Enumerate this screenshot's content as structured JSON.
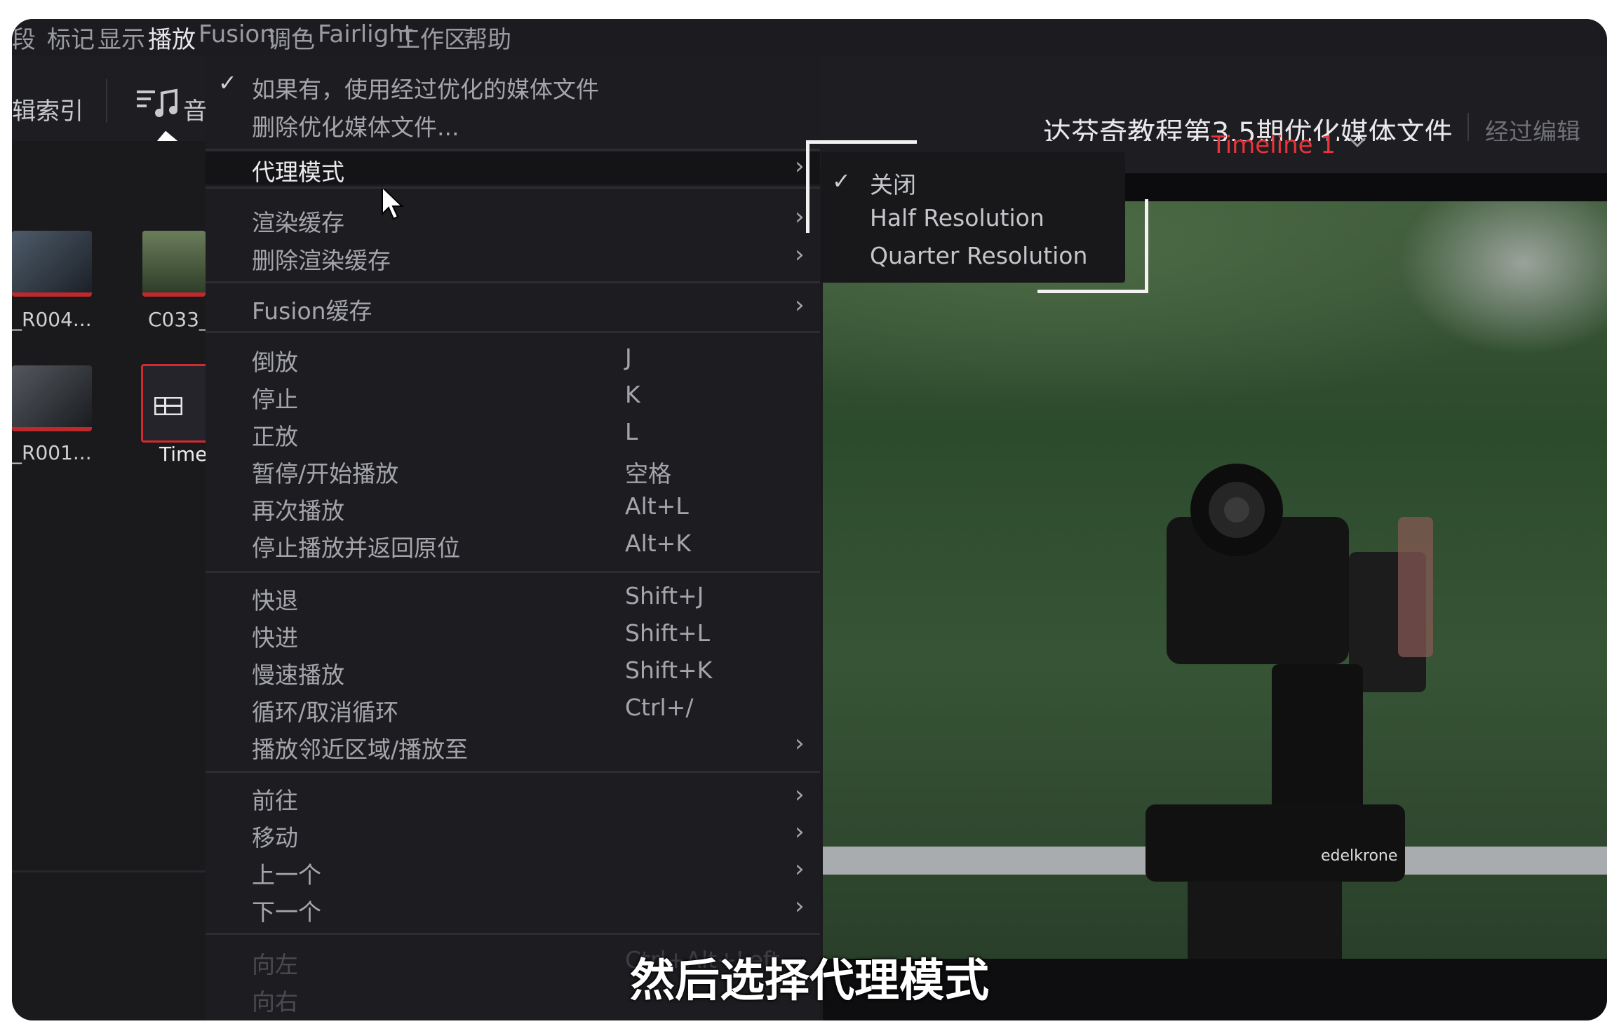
{
  "menubar": {
    "items": [
      "段",
      "标记",
      "显示",
      "播放",
      "Fusion",
      "调色",
      "Fairlight",
      "工作区",
      "帮助"
    ],
    "active_index": 3
  },
  "toolbar": {
    "left_label": "辑索引",
    "audio_label": "音",
    "project_title": "达芬奇教程第3.5期优化媒体文件",
    "project_state": "经过编辑",
    "timeline_name": "Timeline 1"
  },
  "media_pool": {
    "clips": [
      {
        "label": "_R004..."
      },
      {
        "label": "C033_"
      },
      {
        "label": "_R001..."
      },
      {
        "label": "Time"
      }
    ]
  },
  "dropdown": {
    "top_items": [
      {
        "label": "如果有，使用经过优化的媒体文件",
        "checked": true
      },
      {
        "label": "删除优化媒体文件..."
      }
    ],
    "proxy_mode": {
      "label": "代理模式",
      "submenu": true
    },
    "cache_items": [
      {
        "label": "渲染缓存",
        "submenu": true
      },
      {
        "label": "删除渲染缓存",
        "submenu": true
      }
    ],
    "fusion_cache": {
      "label": "Fusion缓存",
      "submenu": true
    },
    "transport": [
      {
        "label": "倒放",
        "shortcut": "J"
      },
      {
        "label": "停止",
        "shortcut": "K"
      },
      {
        "label": "正放",
        "shortcut": "L"
      },
      {
        "label": "暂停/开始播放",
        "shortcut": "空格"
      },
      {
        "label": "再次播放",
        "shortcut": "Alt+L"
      },
      {
        "label": "停止播放并返回原位",
        "shortcut": "Alt+K"
      }
    ],
    "speed": [
      {
        "label": "快退",
        "shortcut": "Shift+J"
      },
      {
        "label": "快进",
        "shortcut": "Shift+L"
      },
      {
        "label": "慢速播放",
        "shortcut": "Shift+K"
      },
      {
        "label": "循环/取消循环",
        "shortcut": "Ctrl+/"
      },
      {
        "label": "播放邻近区域/播放至",
        "shortcut": ""
      }
    ],
    "navigation": [
      {
        "label": "前往"
      },
      {
        "label": "移动"
      },
      {
        "label": "上一个"
      },
      {
        "label": "下一个"
      }
    ],
    "bottom": [
      {
        "label": "向左",
        "shortcut": "Ctrl+Alt+Left"
      },
      {
        "label": "向右",
        "shortcut": ""
      }
    ]
  },
  "submenu": {
    "items": [
      {
        "label": "关闭",
        "checked": true
      },
      {
        "label": "Half Resolution"
      },
      {
        "label": "Quarter Resolution"
      }
    ]
  },
  "viewer": {
    "brand_text": "edelkrone"
  },
  "caption": "然后选择代理模式",
  "colors": {
    "accent_red": "#e8343a",
    "menu_bg": "#1d1d21",
    "highlight": "#141417"
  }
}
